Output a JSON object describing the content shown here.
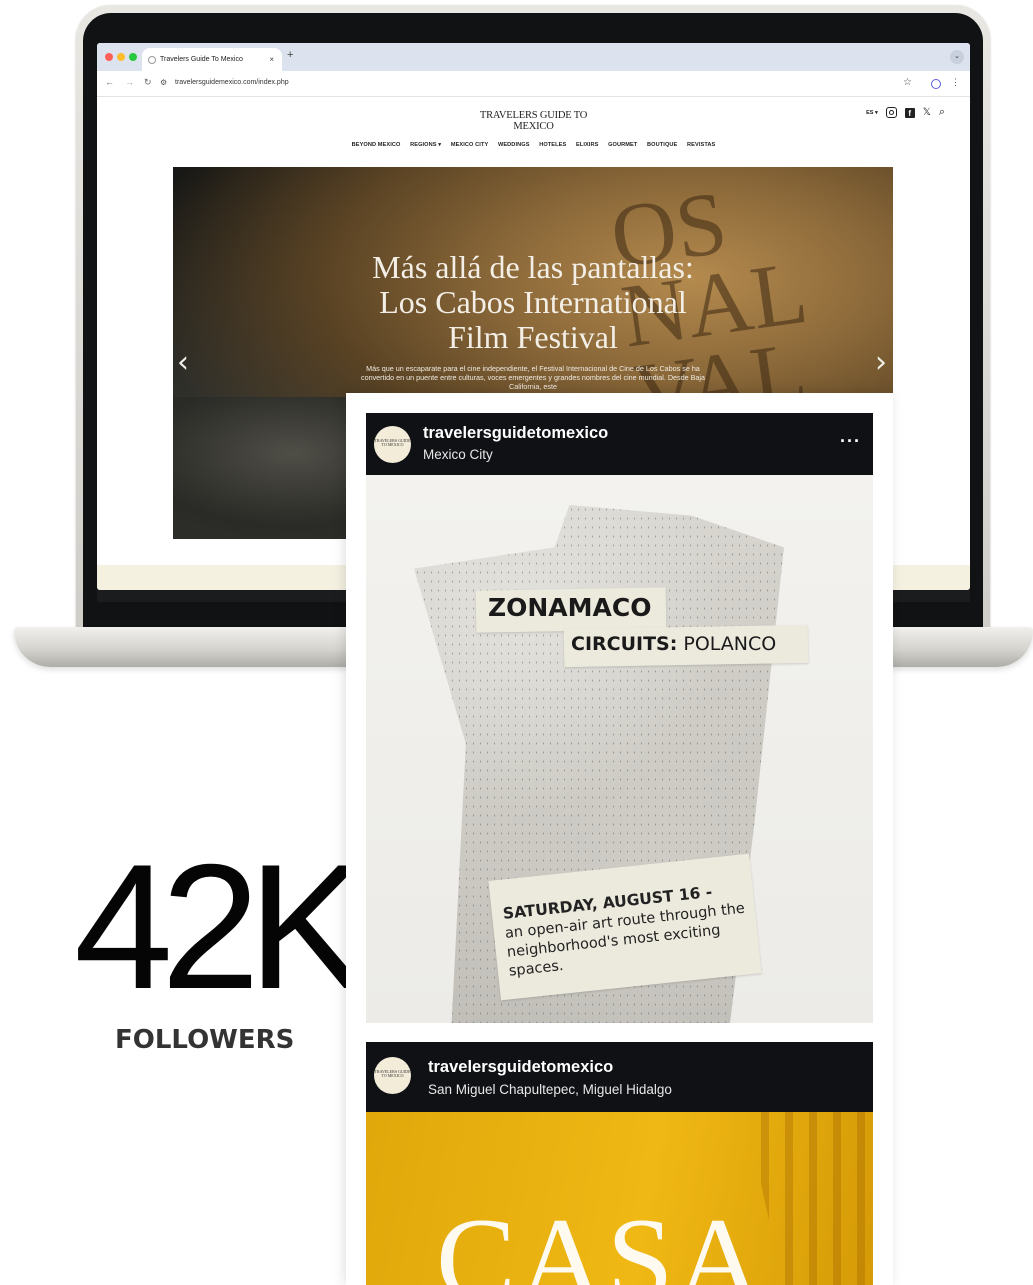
{
  "browser": {
    "tab_title": "Travelers Guide To Mexico",
    "tab_close": "×",
    "new_tab": "+",
    "url": "travelersguidemexico.com/index.php"
  },
  "site": {
    "logo_line1": "TRAVELERS GUIDE TO",
    "logo_line2": "MEXICO",
    "lang": "ES ▾",
    "nav": [
      "BEYOND MEXICO",
      "REGIONS ▾",
      "MEXICO CITY",
      "WEDDINGS",
      "HOTELES",
      "ELIXIRS",
      "GOURMET",
      "BOUTIQUE",
      "REVISTAS"
    ],
    "hero_title_1": "Más allá de las pantallas:",
    "hero_title_2": "Los Cabos International",
    "hero_title_3": "Film Festival",
    "hero_sub": "Más que un escaparate para el cine independiente, el Festival Internacional de Cine de Los Cabos se ha convertido en un puente entre culturas, voces emergentes y grandes nombres del cine mundial. Desde Baja California, este",
    "prev": "‹",
    "next": "›"
  },
  "stats": {
    "followers_count": "42K",
    "followers_label": "FOLLOWERS"
  },
  "feed": {
    "post1": {
      "username": "travelersguidetomexico",
      "location": "Mexico City",
      "avatar_text": "TRAVELERS GUIDE TO MEXICO",
      "image_title": "ZONAMACO",
      "image_sub_bold": "CIRCUITS:",
      "image_sub": " POLANCO",
      "image_date": "SATURDAY, AUGUST 16 -",
      "image_desc": "an open-air art route through the neighborhood's most exciting spaces."
    },
    "post2": {
      "username": "travelersguidetomexico",
      "location": "San Miguel Chapultepec, Miguel Hidalgo",
      "avatar_text": "TRAVELERS GUIDE TO MEXICO",
      "image_text": "CASA"
    }
  },
  "colors": {
    "post_header_bg": "#0f1115",
    "post2_bg": "#f0b814",
    "cream": "#f4f1e1"
  }
}
